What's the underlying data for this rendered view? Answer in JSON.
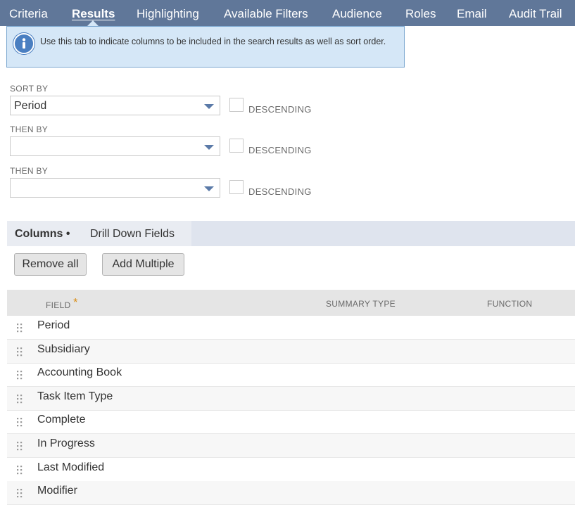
{
  "tabs": [
    {
      "label": "Criteria",
      "active": false
    },
    {
      "label": "Results",
      "active": true
    },
    {
      "label": "Highlighting",
      "active": false
    },
    {
      "label": "Available Filters",
      "active": false
    },
    {
      "label": "Audience",
      "active": false
    },
    {
      "label": "Roles",
      "active": false
    },
    {
      "label": "Email",
      "active": false
    },
    {
      "label": "Audit Trail",
      "active": false
    }
  ],
  "info": {
    "icon": "info-icon",
    "text": "Use this tab to indicate columns to be included in the search results as well as sort order."
  },
  "sort": {
    "sort_by_label": "SORT BY",
    "sort_by_value": "Period",
    "then_by_1_label": "THEN BY",
    "then_by_1_value": "",
    "then_by_2_label": "THEN BY",
    "then_by_2_value": "",
    "descending_label": "DESCENDING"
  },
  "subtabs": {
    "columns": "Columns •",
    "drill_down": "Drill Down Fields"
  },
  "buttons": {
    "remove_all": "Remove all",
    "add_multiple": "Add Multiple"
  },
  "table": {
    "headers": {
      "field": "FIELD",
      "required_mark": "*",
      "summary_type": "SUMMARY TYPE",
      "function": "FUNCTION"
    },
    "rows": [
      "Period",
      "Subsidiary",
      "Accounting Book",
      "Task Item Type",
      "Complete",
      "In Progress",
      "Last Modified",
      "Modifier"
    ]
  },
  "colors": {
    "tab_bar": "#607799",
    "info_bg": "#d5e7f7",
    "accent": "#4a7fc1"
  }
}
